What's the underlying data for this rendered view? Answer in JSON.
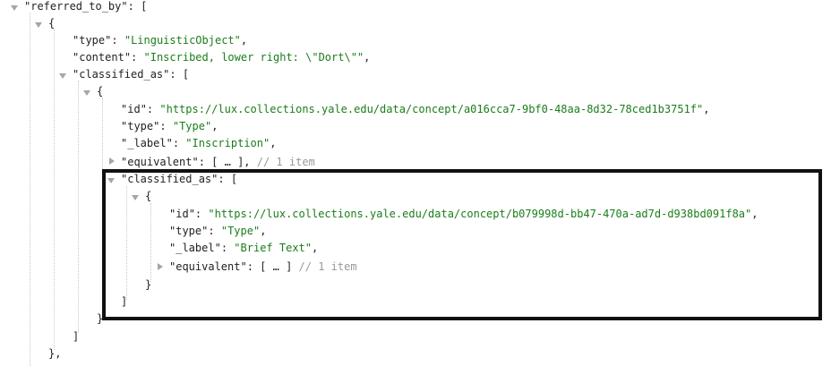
{
  "root_key": "referred_to_by",
  "item": {
    "type_key": "type",
    "type_value": "LinguisticObject",
    "content_key": "content",
    "content_value": "Inscribed, lower right: \\\"Dort\\\"",
    "classified_as_key": "classified_as",
    "inner": {
      "id_key": "id",
      "id_value": "https://lux.collections.yale.edu/data/concept/a016cca7-9bf0-48aa-8d32-78ced1b3751f",
      "type_key": "type",
      "type_value": "Type",
      "label_key": "_label",
      "label_value": "Inscription",
      "equivalent_key": "equivalent",
      "equivalent_comment": "// 1 item",
      "nested_classified_as_key": "classified_as",
      "nested": {
        "id_key": "id",
        "id_value": "https://lux.collections.yale.edu/data/concept/b079998d-bb47-470a-ad7d-d938bd091f8a",
        "type_key": "type",
        "type_value": "Type",
        "label_key": "_label",
        "label_value": "Brief Text",
        "equivalent_key": "equivalent",
        "equivalent_comment": "// 1 item"
      }
    }
  },
  "collapsed_placeholder": "[ … ]"
}
